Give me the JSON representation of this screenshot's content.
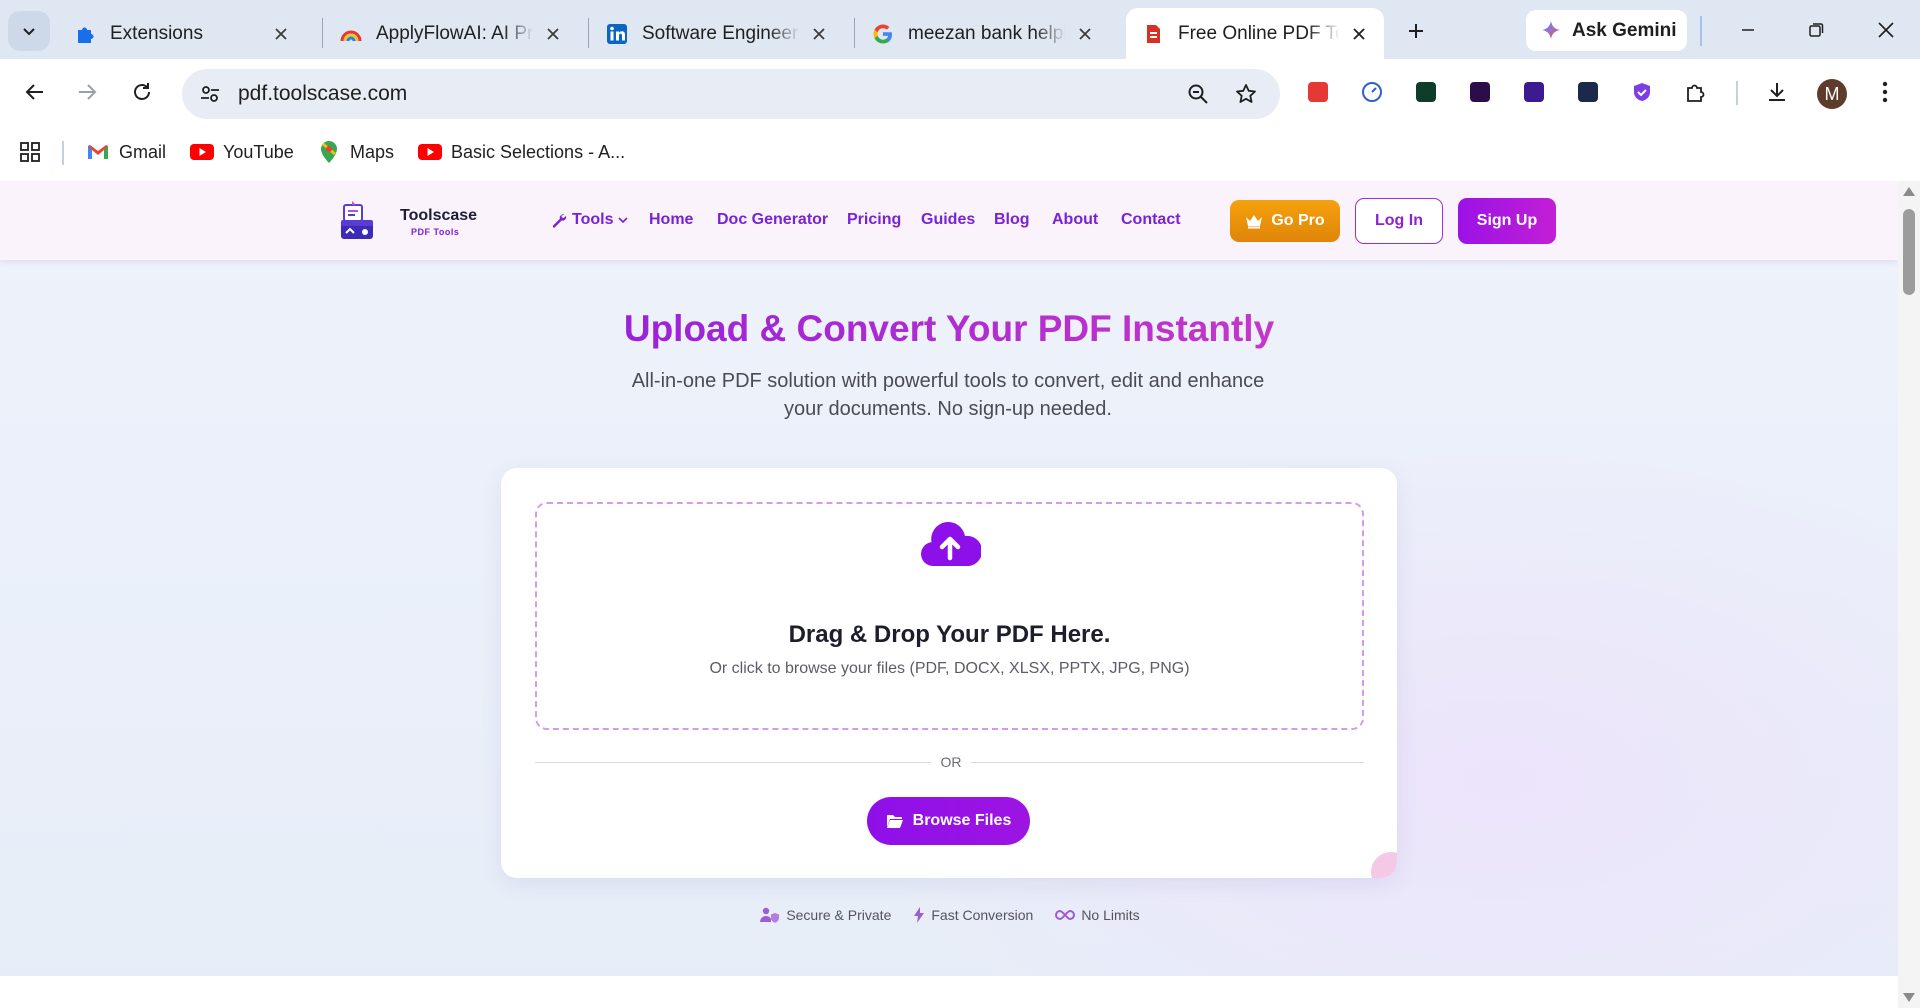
{
  "browser": {
    "tabs": [
      {
        "title": "Extensions"
      },
      {
        "title": "ApplyFlowAI: AI Proposal"
      },
      {
        "title": "Software Engineer - "
      },
      {
        "title": "meezan bank helpline"
      },
      {
        "title": "Free Online PDF Tools"
      }
    ],
    "gemini_label": "Ask Gemini",
    "url": "pdf.toolscase.com",
    "avatar_letter": "M",
    "bookmarks": [
      {
        "label": "Gmail"
      },
      {
        "label": "YouTube"
      },
      {
        "label": "Maps"
      },
      {
        "label": "Basic Selections - A..."
      }
    ]
  },
  "site": {
    "brand_name": "Toolscase",
    "brand_sub": "PDF Tools",
    "nav": {
      "tools": "Tools",
      "home": "Home",
      "doc_generator": "Doc Generator",
      "pricing": "Pricing",
      "guides": "Guides",
      "blog": "Blog",
      "about": "About",
      "contact": "Contact"
    },
    "go_pro": "Go Pro",
    "login": "Log In",
    "signup": "Sign Up"
  },
  "hero": {
    "title": "Upload & Convert Your PDF Instantly",
    "subtitle_line1": "All-in-one PDF solution with powerful tools to convert, edit and enhance",
    "subtitle_line2": "your documents. No sign-up needed."
  },
  "upload": {
    "drop_title": "Drag & Drop Your PDF Here.",
    "drop_sub": "Or click to browse your files (PDF, DOCX, XLSX, PPTX, JPG, PNG)",
    "or": "OR",
    "browse": "Browse Files"
  },
  "features": [
    {
      "label": "Secure & Private",
      "icon": "user-shield-icon"
    },
    {
      "label": "Fast Conversion",
      "icon": "bolt-icon"
    },
    {
      "label": "No Limits",
      "icon": "infinity-icon"
    }
  ],
  "colors": {
    "accent": "#8e10e8",
    "accent_text": "#7a22d6",
    "gopro": "#f0970b"
  }
}
